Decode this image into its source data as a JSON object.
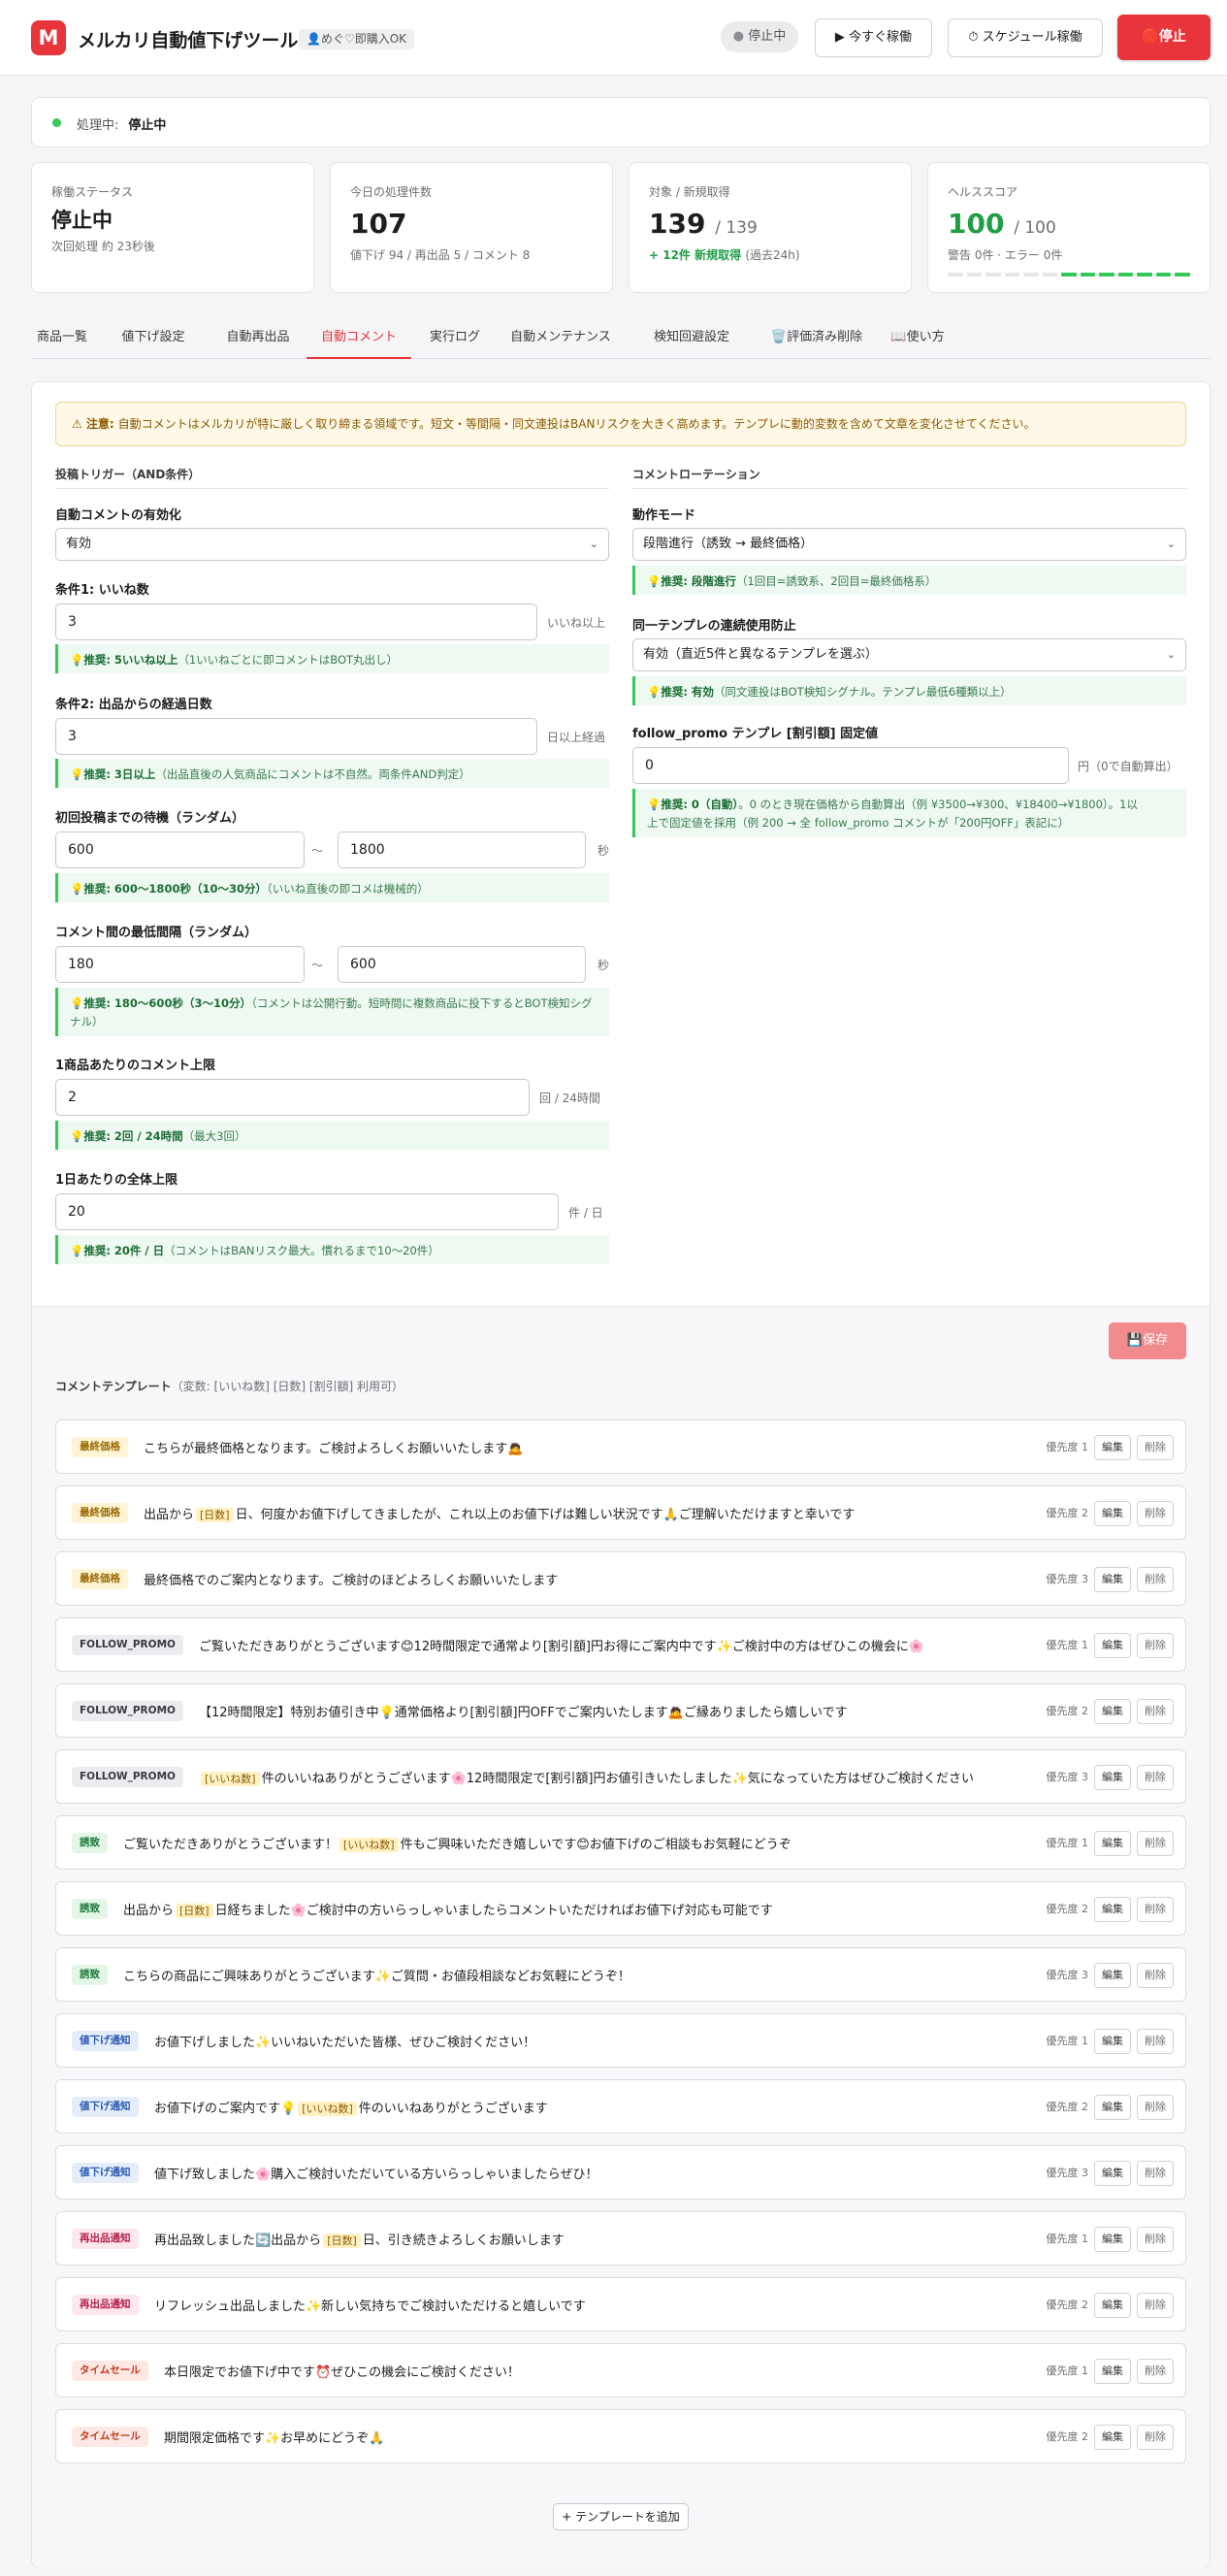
{
  "header": {
    "logo": "M",
    "title": "メルカリ自動値下げツール",
    "user": "👤めぐ♡即購入OK",
    "status": "停止中",
    "btn_run_now": "▶ 今すぐ稼働",
    "btn_schedule": "⏱ スケジュール稼働",
    "btn_stop": "🛑停止"
  },
  "processing": {
    "label": "処理中:",
    "value": "停止中"
  },
  "stats": {
    "status": {
      "label": "稼働ステータス",
      "value": "停止中",
      "sub": "次回処理 約 23秒後"
    },
    "today": {
      "label": "今日の処理件数",
      "value": "107",
      "sub": "値下げ 94 / 再出品 5 / コメント 8"
    },
    "target": {
      "label": "対象 / 新規取得",
      "value": "139",
      "total": "/ 139",
      "new": "+ 12件 新規取得",
      "period": "(過去24h)"
    },
    "health": {
      "label": "ヘルススコア",
      "value": "100",
      "total": "/ 100",
      "sub": "警告 0件 · エラー 0件",
      "level": 0.54
    }
  },
  "tabs": [
    "商品一覧",
    "値下げ設定",
    "自動再出品",
    "自動コメント",
    "実行ログ",
    "自動メンテナンス",
    "検知回避設定",
    "🗑️評価済み削除",
    "📖使い方"
  ],
  "warning": {
    "prefix": "⚠ 注意:",
    "text": "自動コメントはメルカリが特に厳しく取り締まる領域です。短文・等間隔・同文連投はBANリスクを大きく高めます。テンプレに動的変数を含めて文章を変化させてください。"
  },
  "trigger": {
    "title": "投稿トリガー（AND条件）",
    "enable": {
      "label": "自動コメントの有効化",
      "value": "有効"
    },
    "likes": {
      "label": "条件1: いいね数",
      "value": "3",
      "unit": "いいね以上",
      "tip_b": "推奨: 5いいね以上",
      "tip": "（1いいねごとに即コメントはBOT丸出し）"
    },
    "days": {
      "label": "条件2: 出品からの経過日数",
      "value": "3",
      "unit": "日以上経過",
      "tip_b": "推奨: 3日以上",
      "tip": "（出品直後の人気商品にコメントは不自然。両条件AND判定）"
    },
    "wait": {
      "label": "初回投稿までの待機（ランダム）",
      "min": "600",
      "max": "1800",
      "sep": "〜",
      "unit": "秒",
      "tip_b": "推奨: 600〜1800秒（10〜30分）",
      "tip": "（いいね直後の即コメは機械的）"
    },
    "interval": {
      "label": "コメント間の最低間隔（ランダム）",
      "min": "180",
      "max": "600",
      "sep": "〜",
      "unit": "秒",
      "tip_b": "推奨: 180〜600秒（3〜10分）",
      "tip": "（コメントは公開行動。短時間に複数商品に投下するとBOT検知シグナル）"
    },
    "per_item": {
      "label": "1商品あたりのコメント上限",
      "value": "2",
      "unit": "回 / 24時間",
      "tip_b": "推奨: 2回 / 24時間",
      "tip": "（最大3回）"
    },
    "daily": {
      "label": "1日あたりの全体上限",
      "value": "20",
      "unit": "件 / 日",
      "tip_b": "推奨: 20件 / 日",
      "tip": "（コメントはBANリスク最大。慣れるまで10〜20件）"
    }
  },
  "rotation": {
    "title": "コメントローテーション",
    "mode": {
      "label": "動作モード",
      "value": "段階進行（誘致 → 最終価格）",
      "tip_b": "推奨: 段階進行",
      "tip": "（1回目=誘致系、2回目=最終価格系）"
    },
    "repeat": {
      "label": "同一テンプレの連続使用防止",
      "value": "有効（直近5件と異なるテンプレを選ぶ）",
      "tip_b": "推奨: 有効",
      "tip": "（同文連投はBOT検知シグナル。テンプレ最低6種類以上）"
    },
    "promo": {
      "label": "follow_promo テンプレ [割引額] 固定値",
      "value": "0",
      "unit": "円（0で自動算出）",
      "tip_b": "推奨: 0（自動）",
      "tip1": "。0 のとき現在価格から自動算出（例 ¥3500→¥300、¥18400→¥1800）。1以",
      "tip2": "上で固定値を採用（例 200 → 全 follow_promo コメントが「200円OFF」表記に）"
    }
  },
  "save": "💾保存",
  "templates_head": {
    "title": "コメントテンプレート",
    "vars": "（変数: [いいね数] [日数] [割引額] 利用可）"
  },
  "templates": [
    {
      "tag": "最終価格",
      "text": "こちらが最終価格となります。ご検討よろしくお願いいたします🙇",
      "prio": "優先度 1"
    },
    {
      "tag": "最終価格",
      "pre": "出品から",
      "var": "[日数]",
      "text": "日、何度かお値下げしてきましたが、これ以上のお値下げは難しい状況です🙏ご理解いただけますと幸いです",
      "prio": "優先度 2"
    },
    {
      "tag": "最終価格",
      "text": "最終価格でのご案内となります。ご検討のほどよろしくお願いいたします",
      "prio": "優先度 3"
    },
    {
      "tag": "FOLLOW_PROMO",
      "text": "ご覧いただきありがとうございます😊12時間限定で通常より[割引額]円お得にご案内中です✨ご検討中の方はぜひこの機会に🌸",
      "prio": "優先度 1"
    },
    {
      "tag": "FOLLOW_PROMO",
      "text": "【12時間限定】特別お値引き中💡通常価格より[割引額]円OFFでご案内いたします🙇ご縁ありましたら嬉しいです",
      "prio": "優先度 2"
    },
    {
      "tag": "FOLLOW_PROMO",
      "var": "[いいね数]",
      "text": "件のいいねありがとうございます🌸12時間限定で[割引額]円お値引きいたしました✨気になっていた方はぜひご検討ください",
      "prio": "優先度 3"
    },
    {
      "tag": "誘致",
      "pre": "ご覧いただきありがとうございます！",
      "var": "[いいね数]",
      "text": "件もご興味いただき嬉しいです😊お値下げのご相談もお気軽にどうぞ",
      "prio": "優先度 1"
    },
    {
      "tag": "誘致",
      "pre": "出品から",
      "var": "[日数]",
      "text": "日経ちました🌸ご検討中の方いらっしゃいましたらコメントいただければお値下げ対応も可能です",
      "prio": "優先度 2"
    },
    {
      "tag": "誘致",
      "text": "こちらの商品にご興味ありがとうございます✨ご質問・お値段相談などお気軽にどうぞ！",
      "prio": "優先度 3"
    },
    {
      "tag": "値下げ通知",
      "text": "お値下げしました✨いいねいただいた皆様、ぜひご検討ください！",
      "prio": "優先度 1"
    },
    {
      "tag": "値下げ通知",
      "pre": "お値下げのご案内です💡",
      "var": "[いいね数]",
      "text": "件のいいねありがとうございます",
      "prio": "優先度 2"
    },
    {
      "tag": "値下げ通知",
      "text": "値下げ致しました🌸購入ご検討いただいている方いらっしゃいましたらぜひ！",
      "prio": "優先度 3"
    },
    {
      "tag": "再出品通知",
      "pre": "再出品致しました🔄出品から",
      "var": "[日数]",
      "text": "日、引き続きよろしくお願いします",
      "prio": "優先度 1"
    },
    {
      "tag": "再出品通知",
      "text": "リフレッシュ出品しました✨新しい気持ちでご検討いただけると嬉しいです",
      "prio": "優先度 2"
    },
    {
      "tag": "タイムセール",
      "text": "本日限定でお値下げ中です⏰ぜひこの機会にご検討ください！",
      "prio": "優先度 1"
    },
    {
      "tag": "タイムセール",
      "text": "期間限定価格です✨お早めにどうぞ🙏",
      "prio": "優先度 2"
    }
  ],
  "row_buttons": {
    "edit": "編集",
    "delete": "削除"
  },
  "add_template": "+ テンプレートを追加",
  "colors": {
    "accent": "#e8353b",
    "ok": "#34c759",
    "tag_final": "#fff4d6",
    "tag_promo": "#ececf0",
    "tag_lure": "#e4f6e8",
    "tag_price": "#e5edfb",
    "tag_relist": "#fde6ec",
    "tag_sale": "#fde8e3"
  }
}
